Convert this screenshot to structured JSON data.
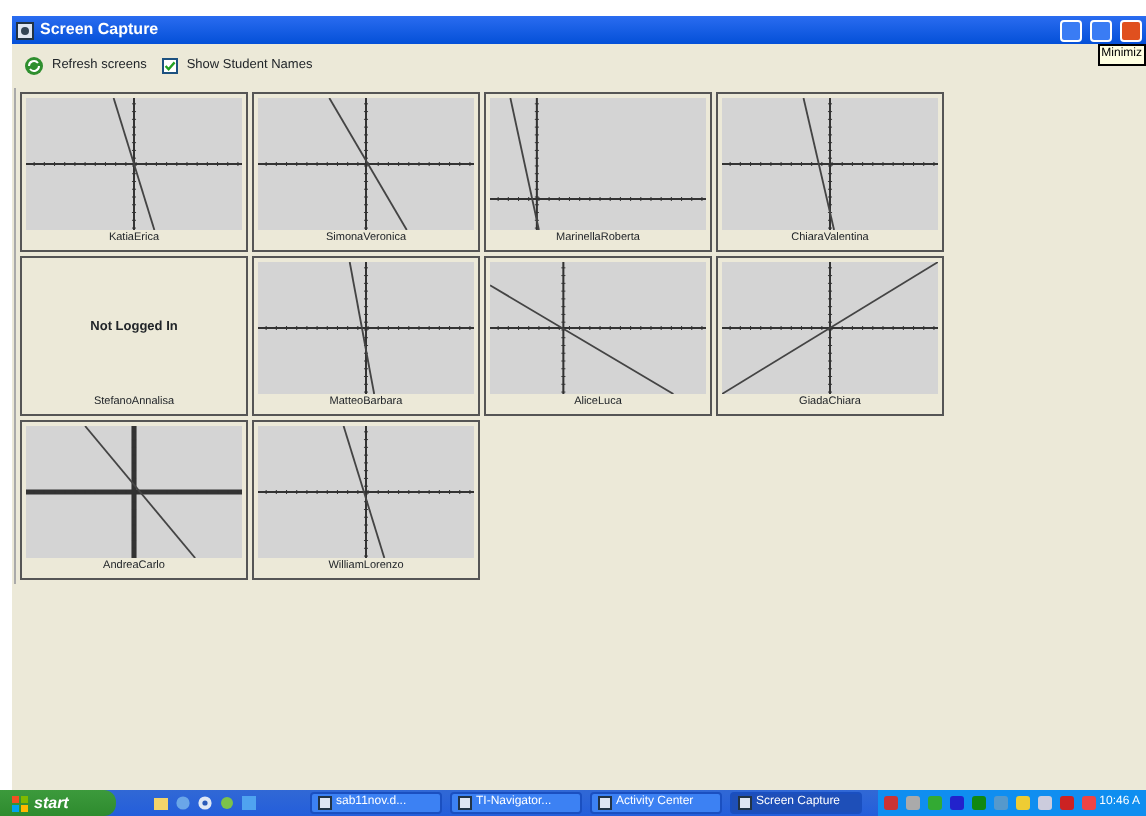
{
  "window": {
    "title": "Screen Capture",
    "tooltip": "Minimiz"
  },
  "toolbar": {
    "refresh_label": "Refresh screens",
    "show_names": {
      "label": "Show Student Names",
      "checked": true
    }
  },
  "students": [
    {
      "name": "KatiaErica",
      "kind": "graph"
    },
    {
      "name": "SimonaVeronica",
      "kind": "graph"
    },
    {
      "name": "MarinellaRoberta",
      "kind": "graph"
    },
    {
      "name": "ChiaraValentina",
      "kind": "graph"
    },
    {
      "name": "StefanoAnnalisa",
      "kind": "offline",
      "message": "Not Logged In"
    },
    {
      "name": "MatteoBarbara",
      "kind": "graph"
    },
    {
      "name": "AliceLuca",
      "kind": "graph"
    },
    {
      "name": "GiadaChiara",
      "kind": "graph"
    },
    {
      "name": "AndreaCarlo",
      "kind": "graph"
    },
    {
      "name": "WilliamLorenzo",
      "kind": "graph"
    }
  ],
  "taskbar": {
    "start": "start",
    "tasks": [
      {
        "label": "sab11nov.d...",
        "selected": false
      },
      {
        "label": "TI-Navigator...",
        "selected": false
      },
      {
        "label": "Activity Center",
        "selected": false
      },
      {
        "label": "Screen Capture",
        "selected": true
      }
    ],
    "clock": "10:46 A"
  }
}
